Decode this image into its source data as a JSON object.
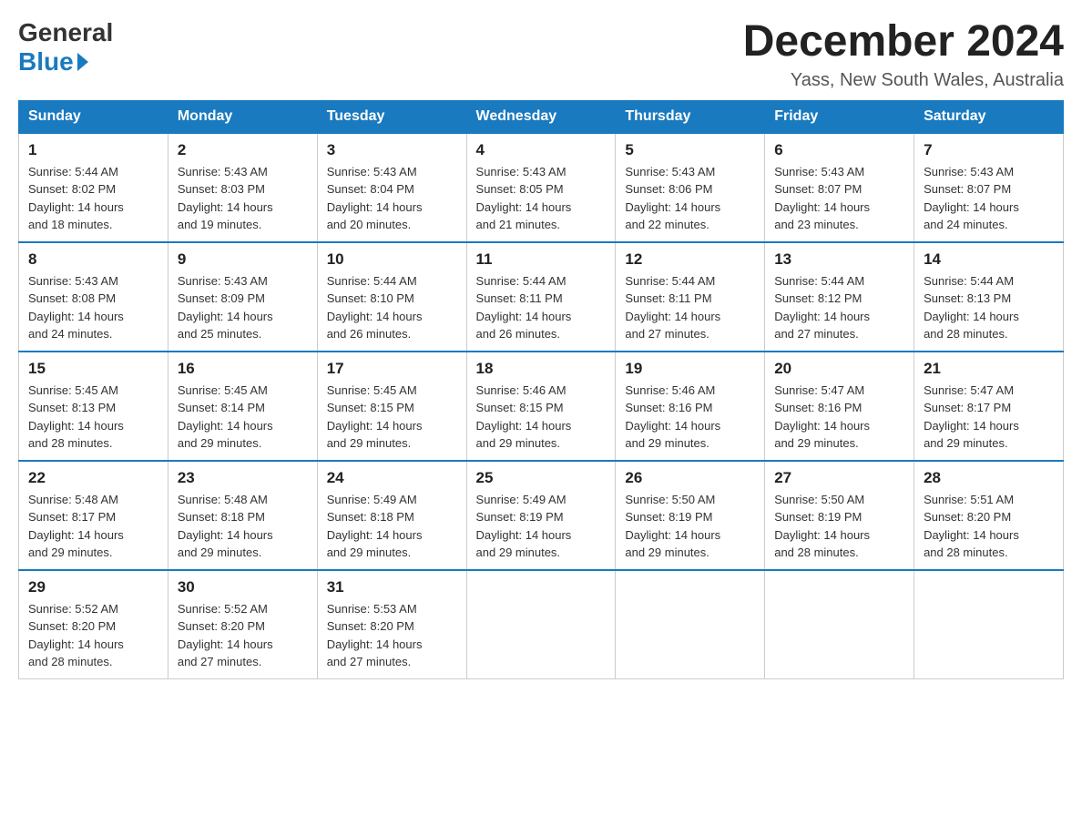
{
  "logo": {
    "general": "General",
    "blue": "Blue",
    "triangle_color": "#1a7abf"
  },
  "header": {
    "title": "December 2024",
    "subtitle": "Yass, New South Wales, Australia"
  },
  "weekdays": [
    "Sunday",
    "Monday",
    "Tuesday",
    "Wednesday",
    "Thursday",
    "Friday",
    "Saturday"
  ],
  "weeks": [
    [
      {
        "day": "1",
        "sunrise": "5:44 AM",
        "sunset": "8:02 PM",
        "daylight": "14 hours and 18 minutes."
      },
      {
        "day": "2",
        "sunrise": "5:43 AM",
        "sunset": "8:03 PM",
        "daylight": "14 hours and 19 minutes."
      },
      {
        "day": "3",
        "sunrise": "5:43 AM",
        "sunset": "8:04 PM",
        "daylight": "14 hours and 20 minutes."
      },
      {
        "day": "4",
        "sunrise": "5:43 AM",
        "sunset": "8:05 PM",
        "daylight": "14 hours and 21 minutes."
      },
      {
        "day": "5",
        "sunrise": "5:43 AM",
        "sunset": "8:06 PM",
        "daylight": "14 hours and 22 minutes."
      },
      {
        "day": "6",
        "sunrise": "5:43 AM",
        "sunset": "8:07 PM",
        "daylight": "14 hours and 23 minutes."
      },
      {
        "day": "7",
        "sunrise": "5:43 AM",
        "sunset": "8:07 PM",
        "daylight": "14 hours and 24 minutes."
      }
    ],
    [
      {
        "day": "8",
        "sunrise": "5:43 AM",
        "sunset": "8:08 PM",
        "daylight": "14 hours and 24 minutes."
      },
      {
        "day": "9",
        "sunrise": "5:43 AM",
        "sunset": "8:09 PM",
        "daylight": "14 hours and 25 minutes."
      },
      {
        "day": "10",
        "sunrise": "5:44 AM",
        "sunset": "8:10 PM",
        "daylight": "14 hours and 26 minutes."
      },
      {
        "day": "11",
        "sunrise": "5:44 AM",
        "sunset": "8:11 PM",
        "daylight": "14 hours and 26 minutes."
      },
      {
        "day": "12",
        "sunrise": "5:44 AM",
        "sunset": "8:11 PM",
        "daylight": "14 hours and 27 minutes."
      },
      {
        "day": "13",
        "sunrise": "5:44 AM",
        "sunset": "8:12 PM",
        "daylight": "14 hours and 27 minutes."
      },
      {
        "day": "14",
        "sunrise": "5:44 AM",
        "sunset": "8:13 PM",
        "daylight": "14 hours and 28 minutes."
      }
    ],
    [
      {
        "day": "15",
        "sunrise": "5:45 AM",
        "sunset": "8:13 PM",
        "daylight": "14 hours and 28 minutes."
      },
      {
        "day": "16",
        "sunrise": "5:45 AM",
        "sunset": "8:14 PM",
        "daylight": "14 hours and 29 minutes."
      },
      {
        "day": "17",
        "sunrise": "5:45 AM",
        "sunset": "8:15 PM",
        "daylight": "14 hours and 29 minutes."
      },
      {
        "day": "18",
        "sunrise": "5:46 AM",
        "sunset": "8:15 PM",
        "daylight": "14 hours and 29 minutes."
      },
      {
        "day": "19",
        "sunrise": "5:46 AM",
        "sunset": "8:16 PM",
        "daylight": "14 hours and 29 minutes."
      },
      {
        "day": "20",
        "sunrise": "5:47 AM",
        "sunset": "8:16 PM",
        "daylight": "14 hours and 29 minutes."
      },
      {
        "day": "21",
        "sunrise": "5:47 AM",
        "sunset": "8:17 PM",
        "daylight": "14 hours and 29 minutes."
      }
    ],
    [
      {
        "day": "22",
        "sunrise": "5:48 AM",
        "sunset": "8:17 PM",
        "daylight": "14 hours and 29 minutes."
      },
      {
        "day": "23",
        "sunrise": "5:48 AM",
        "sunset": "8:18 PM",
        "daylight": "14 hours and 29 minutes."
      },
      {
        "day": "24",
        "sunrise": "5:49 AM",
        "sunset": "8:18 PM",
        "daylight": "14 hours and 29 minutes."
      },
      {
        "day": "25",
        "sunrise": "5:49 AM",
        "sunset": "8:19 PM",
        "daylight": "14 hours and 29 minutes."
      },
      {
        "day": "26",
        "sunrise": "5:50 AM",
        "sunset": "8:19 PM",
        "daylight": "14 hours and 29 minutes."
      },
      {
        "day": "27",
        "sunrise": "5:50 AM",
        "sunset": "8:19 PM",
        "daylight": "14 hours and 28 minutes."
      },
      {
        "day": "28",
        "sunrise": "5:51 AM",
        "sunset": "8:20 PM",
        "daylight": "14 hours and 28 minutes."
      }
    ],
    [
      {
        "day": "29",
        "sunrise": "5:52 AM",
        "sunset": "8:20 PM",
        "daylight": "14 hours and 28 minutes."
      },
      {
        "day": "30",
        "sunrise": "5:52 AM",
        "sunset": "8:20 PM",
        "daylight": "14 hours and 27 minutes."
      },
      {
        "day": "31",
        "sunrise": "5:53 AM",
        "sunset": "8:20 PM",
        "daylight": "14 hours and 27 minutes."
      },
      null,
      null,
      null,
      null
    ]
  ],
  "labels": {
    "sunrise": "Sunrise:",
    "sunset": "Sunset:",
    "daylight": "Daylight:"
  }
}
